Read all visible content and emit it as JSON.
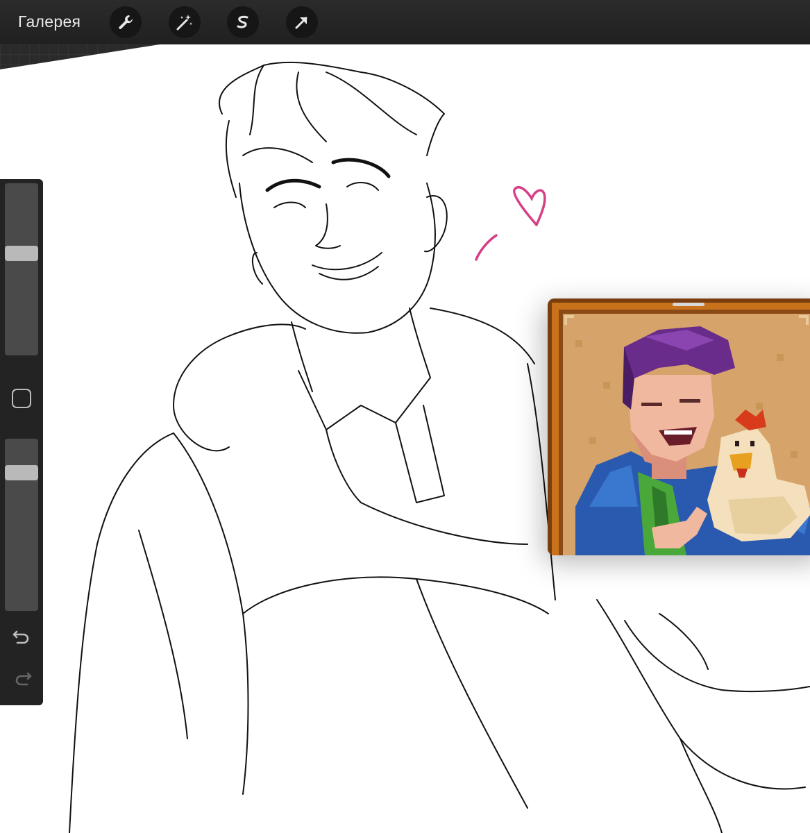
{
  "toolbar": {
    "gallery_label": "Галерея",
    "tools": [
      {
        "name": "wrench-icon"
      },
      {
        "name": "magic-wand-icon"
      },
      {
        "name": "selection-s-icon"
      },
      {
        "name": "transform-arrow-icon"
      }
    ]
  },
  "sidebar": {
    "brush_size_level": 0.4,
    "opacity_level": 0.17,
    "modify_button": "square-icon",
    "undo": "undo-icon",
    "redo": "redo-icon"
  },
  "reference": {
    "icon": "pixel-portrait-image"
  },
  "colors": {
    "toolbar_bg": "#232323",
    "heart": "#d63f86",
    "frame_orange": "#c9721c",
    "parchment": "#d6a46a"
  }
}
